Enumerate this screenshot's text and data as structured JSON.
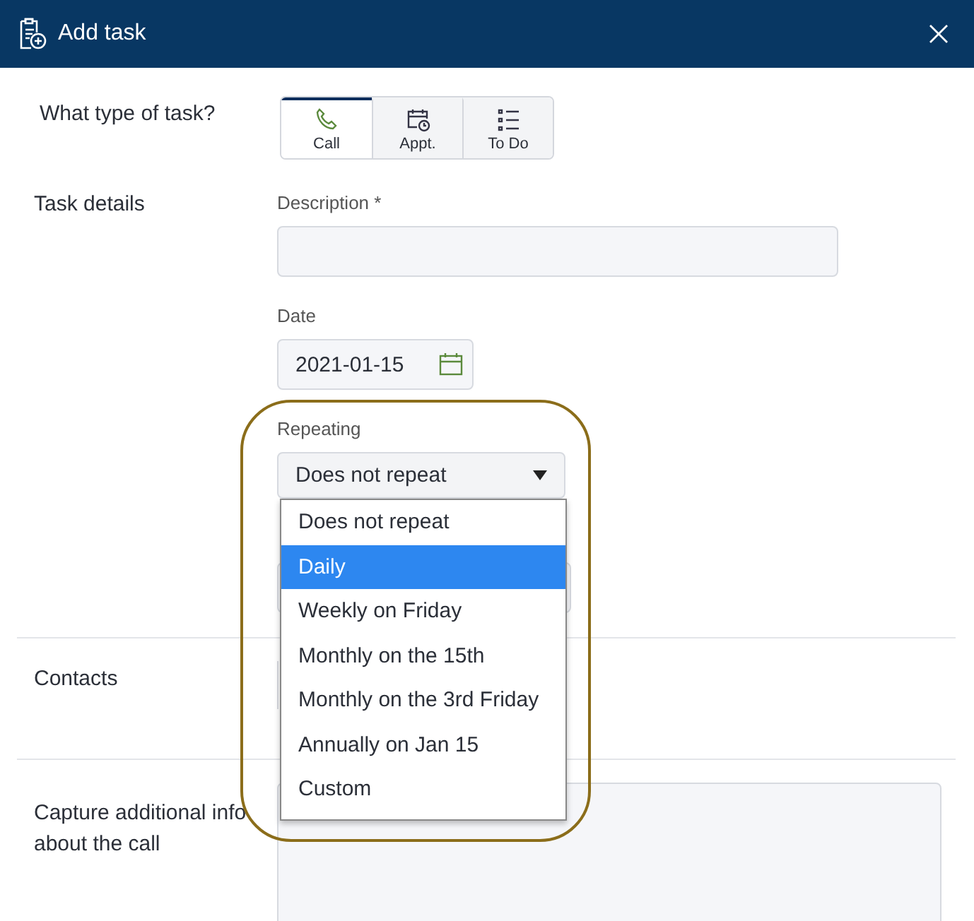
{
  "dialog": {
    "title": "Add task"
  },
  "task_type": {
    "label": "What type of task?",
    "options": [
      {
        "kind": "call",
        "label": "Call",
        "selected": true
      },
      {
        "kind": "appointment",
        "label": "Appt.",
        "selected": false
      },
      {
        "kind": "todo",
        "label": "To Do",
        "selected": false
      }
    ]
  },
  "task_details": {
    "label": "Task details",
    "description": {
      "label": "Description *"
    },
    "date": {
      "label": "Date",
      "value": "2021-01-15"
    },
    "repeating": {
      "label": "Repeating",
      "value": "Does not repeat",
      "open": true,
      "options": [
        {
          "label": "Does not repeat",
          "highlighted": false
        },
        {
          "label": "Daily",
          "highlighted": true
        },
        {
          "label": "Weekly on Friday",
          "highlighted": false
        },
        {
          "label": "Monthly on the 15th",
          "highlighted": false
        },
        {
          "label": "Monthly on the 3rd Friday",
          "highlighted": false
        },
        {
          "label": "Annually on Jan 15",
          "highlighted": false
        },
        {
          "label": "Custom",
          "highlighted": false
        }
      ]
    }
  },
  "contacts": {
    "label": "Contacts"
  },
  "notes": {
    "label": "Capture additional info about the call"
  }
}
